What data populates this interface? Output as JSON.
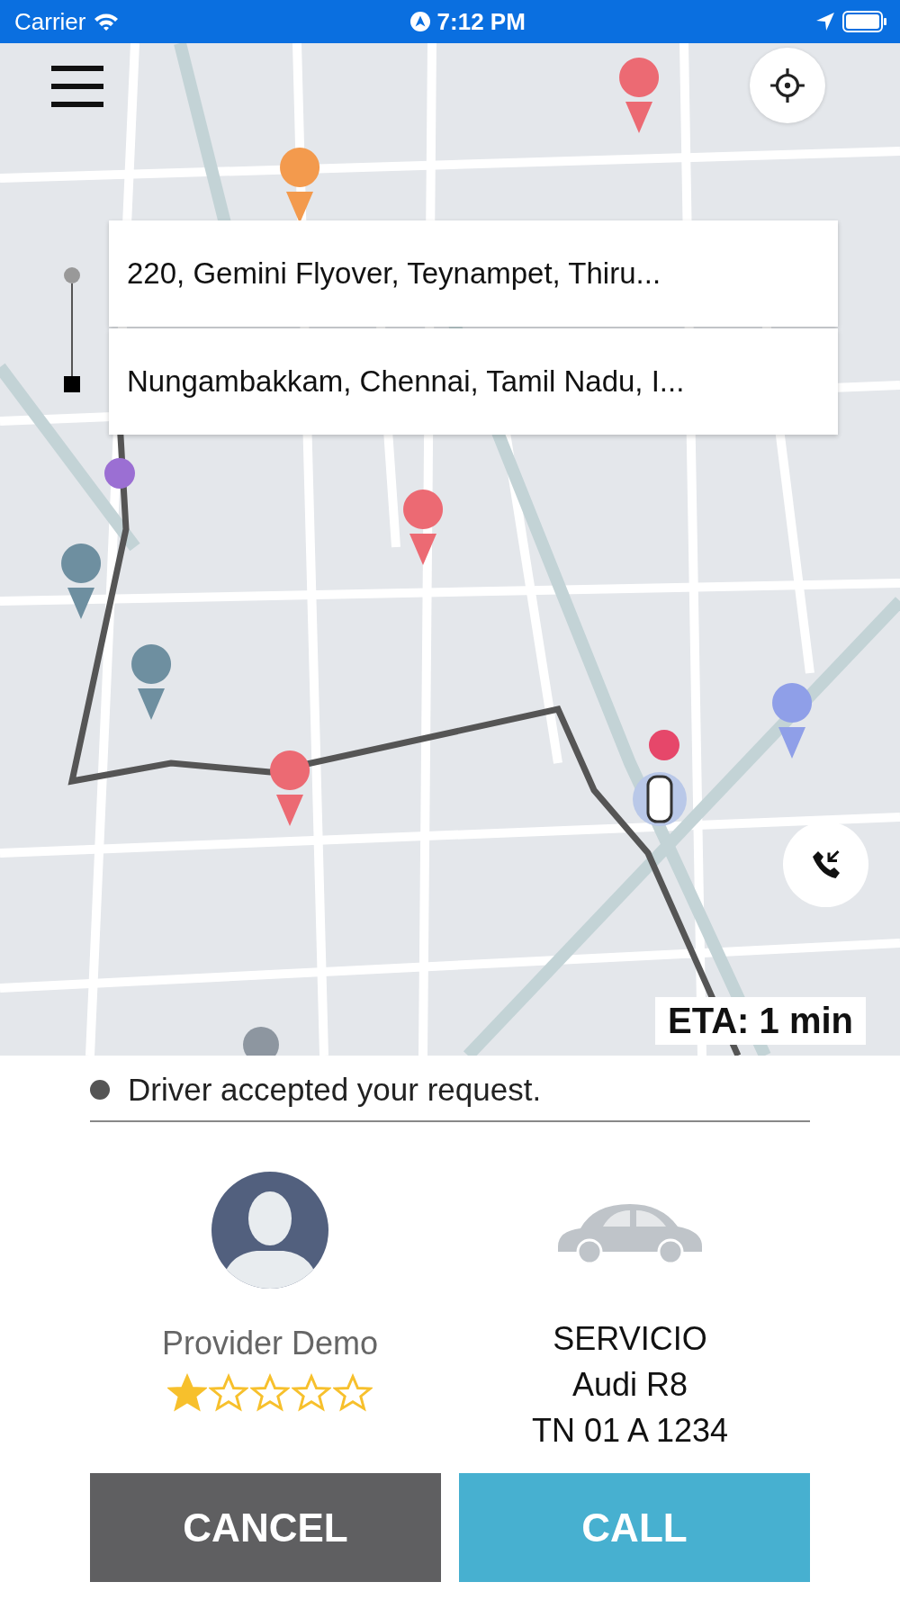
{
  "status_bar": {
    "carrier": "Carrier",
    "time": "7:12 PM"
  },
  "map": {
    "addresses": [
      {
        "text": "220, Gemini Flyover, Teynampet, Thiru..."
      },
      {
        "text": "Nungambakkam, Chennai, Tamil Nadu, I..."
      }
    ],
    "eta": "ETA: 1 min"
  },
  "trip": {
    "status": "Driver accepted your request."
  },
  "driver": {
    "name": "Provider Demo",
    "stars": 1
  },
  "vehicle": {
    "service": "SERVICIO",
    "model": "Audi R8",
    "plate": "TN 01 A 1234"
  },
  "buttons": [
    {
      "kind": "cancel",
      "label": "CANCEL"
    },
    {
      "kind": "call",
      "label": "CALL"
    }
  ]
}
